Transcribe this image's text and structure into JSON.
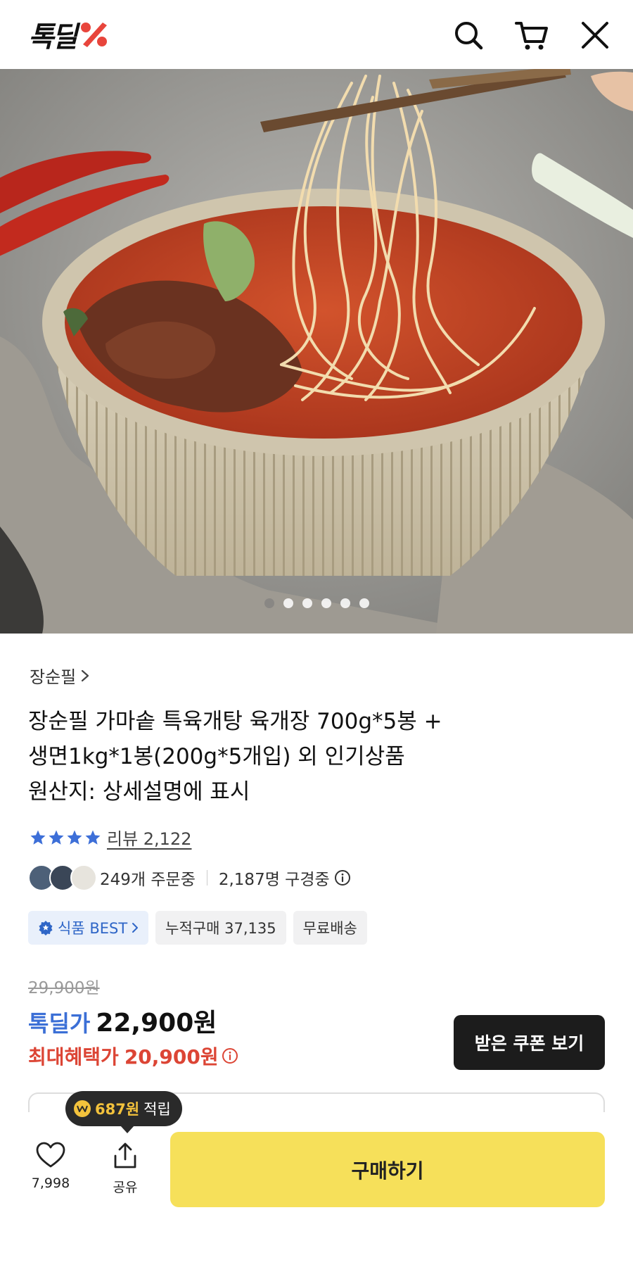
{
  "header": {
    "logo_text": "톡딜",
    "icons": [
      "search-icon",
      "cart-icon",
      "close-icon"
    ],
    "brand_color": "#e8453c"
  },
  "gallery": {
    "image_count": 6,
    "active_index": 0
  },
  "product": {
    "brand": "장순필",
    "title_lines": [
      "장순필 가마솥 특육개탕 육개장 700g*5봉 +",
      "생면1kg*1봉(200g*5개입) 외 인기상품",
      "원산지: 상세설명에 표시"
    ],
    "rating_stars": 4,
    "review_label": "리뷰 2,122",
    "orders_text": "249개 주문중",
    "viewers_text": "2,187명 구경중"
  },
  "tags": {
    "best": "식품 BEST",
    "cumulative": "누적구매 37,135",
    "shipping": "무료배송"
  },
  "price": {
    "original": "29,900원",
    "deal_label": "톡딜가",
    "deal_price": "22,900원",
    "max_label": "최대혜택가",
    "max_price": "20,900원",
    "coupon_button": "받은 쿠폰 보기",
    "accent_blue": "#3b6fd6",
    "accent_red": "#dc4535"
  },
  "bottom_bar": {
    "points_amount": "687원",
    "points_suffix": "적립",
    "like_count": "7,998",
    "share_label": "공유",
    "buy_label": "구매하기",
    "buy_color": "#f6e05a"
  }
}
